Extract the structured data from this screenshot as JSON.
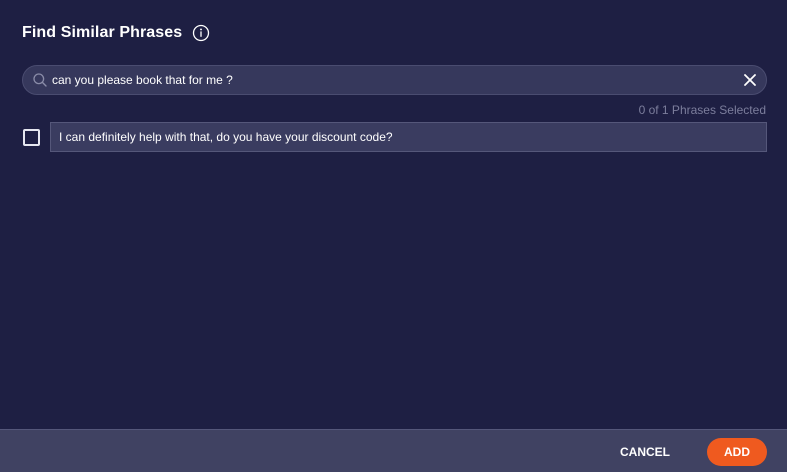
{
  "dialog": {
    "title": "Find Similar Phrases",
    "info_icon": "info-circle-icon"
  },
  "search": {
    "value": "can you please book that for me ?",
    "search_icon": "search-icon",
    "clear_icon": "close-icon"
  },
  "results": {
    "count_text": "0 of 1 Phrases Selected",
    "items": [
      {
        "text": "I can definitely help with that, do you have your discount code?",
        "checked": false
      }
    ]
  },
  "footer": {
    "cancel_label": "CANCEL",
    "add_label": "ADD"
  },
  "colors": {
    "background": "#1e1f43",
    "accent": "#ef5a1f",
    "footer": "#404262"
  }
}
